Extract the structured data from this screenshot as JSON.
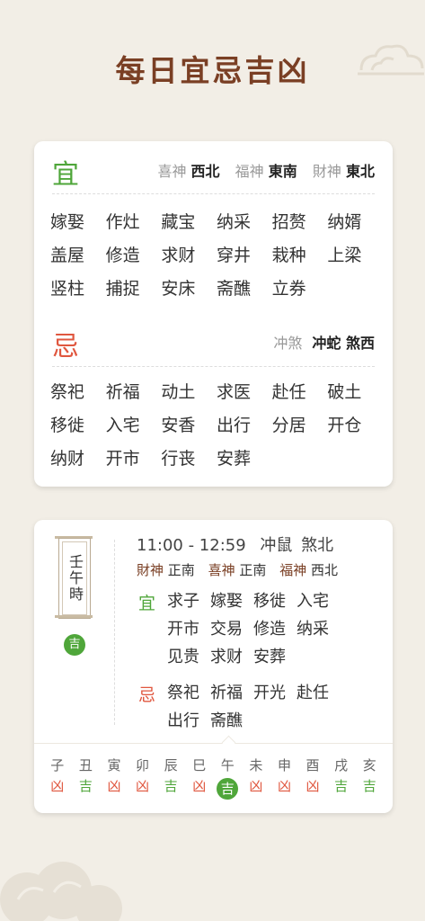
{
  "page_title": "每日宜忌吉凶",
  "day": {
    "yi_label": "宜",
    "ji_label": "忌",
    "gods": [
      {
        "label": "喜神",
        "value": "西北"
      },
      {
        "label": "福神",
        "value": "東南"
      },
      {
        "label": "財神",
        "value": "東北"
      }
    ],
    "chong_label": "冲煞",
    "chong_value": "冲蛇 煞西",
    "yi_items": [
      "嫁娶",
      "作灶",
      "藏宝",
      "纳采",
      "招赘",
      "纳婿",
      "盖屋",
      "修造",
      "求财",
      "穿井",
      "栽种",
      "上梁",
      "竖柱",
      "捕捉",
      "安床",
      "斋醮",
      "立券"
    ],
    "ji_items": [
      "祭祀",
      "祈福",
      "动土",
      "求医",
      "赴任",
      "破土",
      "移徙",
      "入宅",
      "安香",
      "出行",
      "分居",
      "开仓",
      "纳财",
      "开市",
      "行丧",
      "安葬"
    ]
  },
  "hour": {
    "name": "壬午時",
    "badge": "吉",
    "time_range": "11:00 - 12:59",
    "chong": "冲鼠",
    "sha": "煞北",
    "gods": [
      {
        "label": "財神",
        "value": "正南"
      },
      {
        "label": "喜神",
        "value": "正南"
      },
      {
        "label": "福神",
        "value": "西北"
      }
    ],
    "yi_label": "宜",
    "ji_label": "忌",
    "yi_items": [
      "求子",
      "嫁娶",
      "移徙",
      "入宅",
      "开市",
      "交易",
      "修造",
      "纳采",
      "见贵",
      "求财",
      "安葬"
    ],
    "ji_items": [
      "祭祀",
      "祈福",
      "开光",
      "赴任",
      "出行",
      "斋醮"
    ]
  },
  "hours_row": [
    {
      "branch": "子",
      "luck": "凶"
    },
    {
      "branch": "丑",
      "luck": "吉"
    },
    {
      "branch": "寅",
      "luck": "凶"
    },
    {
      "branch": "卯",
      "luck": "凶"
    },
    {
      "branch": "辰",
      "luck": "吉"
    },
    {
      "branch": "巳",
      "luck": "凶"
    },
    {
      "branch": "午",
      "luck": "吉",
      "selected": true
    },
    {
      "branch": "未",
      "luck": "凶"
    },
    {
      "branch": "申",
      "luck": "凶"
    },
    {
      "branch": "酉",
      "luck": "凶"
    },
    {
      "branch": "戌",
      "luck": "吉"
    },
    {
      "branch": "亥",
      "luck": "吉"
    }
  ],
  "colors": {
    "good": "#4fa63a",
    "bad": "#e0573f",
    "title": "#7a3f24",
    "background": "#f2eee6"
  }
}
